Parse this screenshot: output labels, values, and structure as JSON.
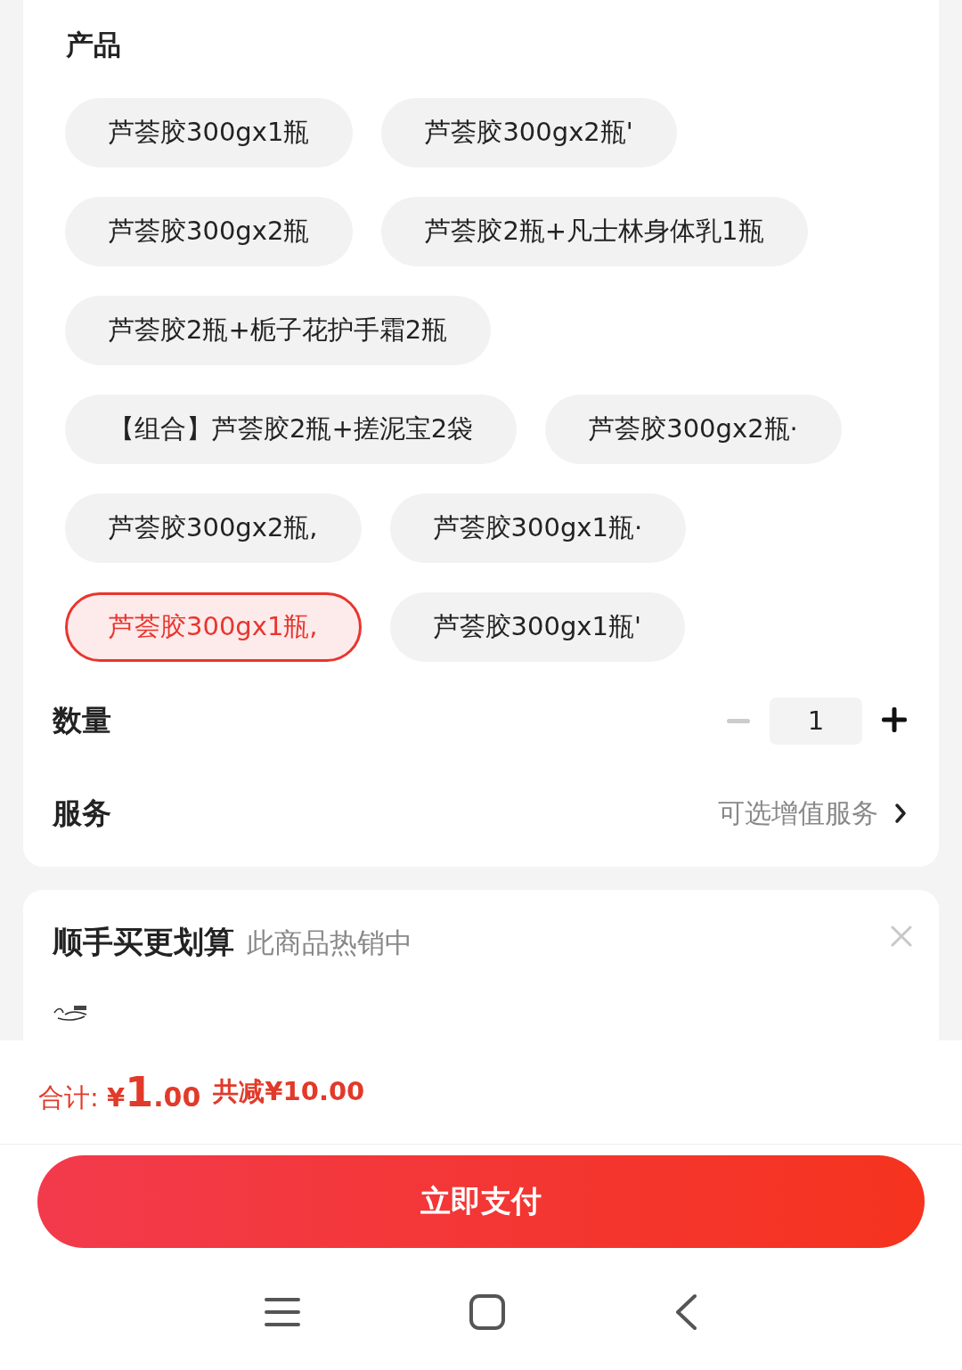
{
  "product_section": {
    "title": "产品",
    "options": [
      {
        "label": "芦荟胶300gx1瓶",
        "selected": false
      },
      {
        "label": "芦荟胶300gx2瓶'",
        "selected": false
      },
      {
        "label": "芦荟胶300gx2瓶",
        "selected": false
      },
      {
        "label": "芦荟胶2瓶+凡士林身体乳1瓶",
        "selected": false
      },
      {
        "label": "芦荟胶2瓶+栀子花护手霜2瓶",
        "selected": false
      },
      {
        "label": "【组合】芦荟胶2瓶+搓泥宝2袋",
        "selected": false
      },
      {
        "label": "芦荟胶300gx2瓶·",
        "selected": false
      },
      {
        "label": "芦荟胶300gx2瓶,",
        "selected": false
      },
      {
        "label": "芦荟胶300gx1瓶·",
        "selected": false
      },
      {
        "label": "芦荟胶300gx1瓶,",
        "selected": true
      },
      {
        "label": "芦荟胶300gx1瓶'",
        "selected": false
      }
    ]
  },
  "quantity": {
    "label": "数量",
    "value": "1",
    "decrease_disabled": true
  },
  "service": {
    "label": "服务",
    "value": "可选增值服务"
  },
  "upsell": {
    "title": "顺手买更划算",
    "subtitle": "此商品热销中"
  },
  "total": {
    "label": "合计:",
    "currency": "¥",
    "amount_integer": "1",
    "amount_decimal": ".00",
    "discount": "共减¥10.00"
  },
  "pay_button": "立即支付"
}
